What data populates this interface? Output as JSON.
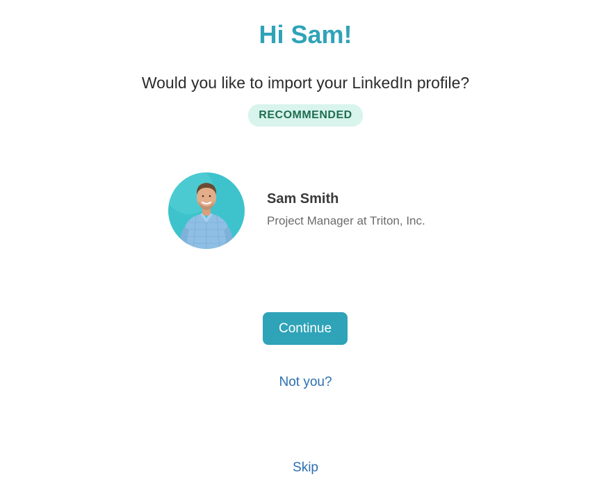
{
  "header": {
    "greeting": "Hi Sam!",
    "question": "Would you like to import your LinkedIn profile?",
    "badge": "RECOMMENDED"
  },
  "profile": {
    "name": "Sam Smith",
    "title": "Project Manager at Triton, Inc."
  },
  "actions": {
    "continue_label": "Continue",
    "not_you_label": "Not you?",
    "skip_label": "Skip"
  },
  "colors": {
    "accent": "#2fa3b8",
    "badge_bg": "#d8f4ec",
    "badge_text": "#1f6e52",
    "link": "#2b6fb0"
  }
}
